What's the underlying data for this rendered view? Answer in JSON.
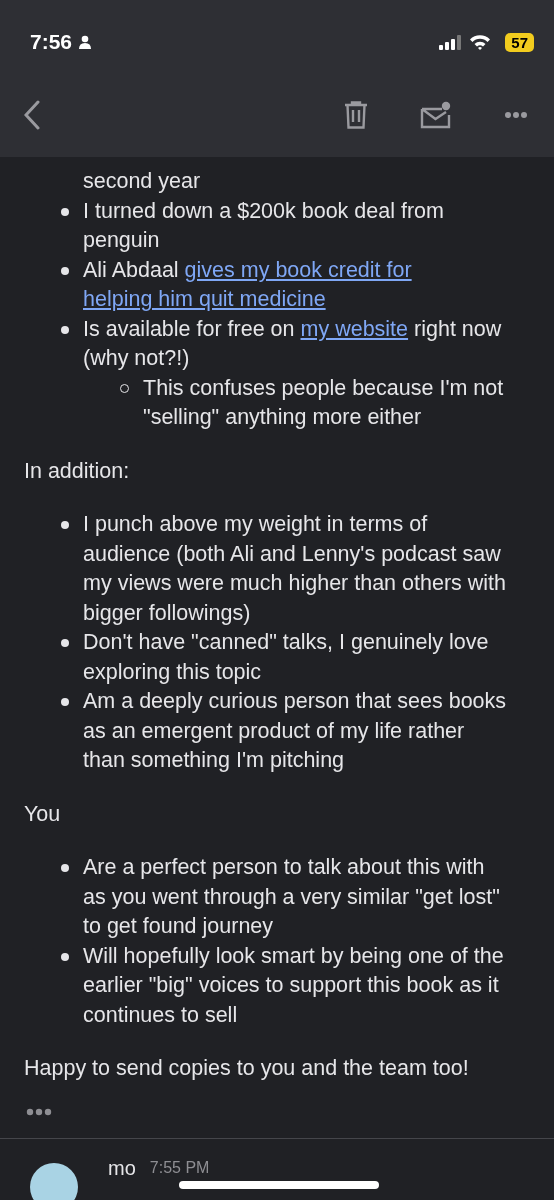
{
  "status_bar": {
    "time": "7:56",
    "battery": "57"
  },
  "email_body": [
    {
      "kind": "list",
      "items": [
        {
          "continued": true,
          "segments": [
            {
              "text": "second year"
            }
          ]
        },
        {
          "segments": [
            {
              "text": "I turned down a $200k book deal from penguin"
            }
          ]
        },
        {
          "segments": [
            {
              "text": "Ali Abdaal "
            },
            {
              "link": "gives my book credit for"
            },
            {
              "link": "helping him quit medicine"
            }
          ]
        },
        {
          "segments": [
            {
              "text": "Is available for free on "
            },
            {
              "link": "my website"
            },
            {
              "text": " right now (why not?!)"
            }
          ],
          "children": [
            {
              "segments": [
                {
                  "text": "This confuses people because I'm not \"selling\" anything more either"
                }
              ]
            }
          ]
        }
      ]
    },
    {
      "kind": "paragraph",
      "text": "In addition:"
    },
    {
      "kind": "list",
      "items": [
        {
          "segments": [
            {
              "text": "I punch above my weight in terms of audience (both Ali and Lenny's podcast saw my views were much higher than others with bigger followings)"
            }
          ]
        },
        {
          "segments": [
            {
              "text": "Don't have \"canned\" talks, I genuinely love exploring this topic"
            }
          ]
        },
        {
          "segments": [
            {
              "text": "Am a deeply curious person that sees books as an emergent product of my life rather than something I'm pitching"
            }
          ]
        }
      ]
    },
    {
      "kind": "paragraph",
      "text": "You"
    },
    {
      "kind": "list",
      "items": [
        {
          "segments": [
            {
              "text": "Are a perfect person to talk about this with as you went through a very similar \"get lost\" to get found journey"
            }
          ]
        },
        {
          "segments": [
            {
              "text": "Will hopefully look smart by being one of the earlier \"big\" voices to support this book as it continues to sell"
            }
          ]
        }
      ]
    },
    {
      "kind": "paragraph",
      "text": "Happy to send copies to you and the team too!"
    }
  ],
  "next_message": {
    "sender": "mo",
    "time": "7:55 PM"
  }
}
